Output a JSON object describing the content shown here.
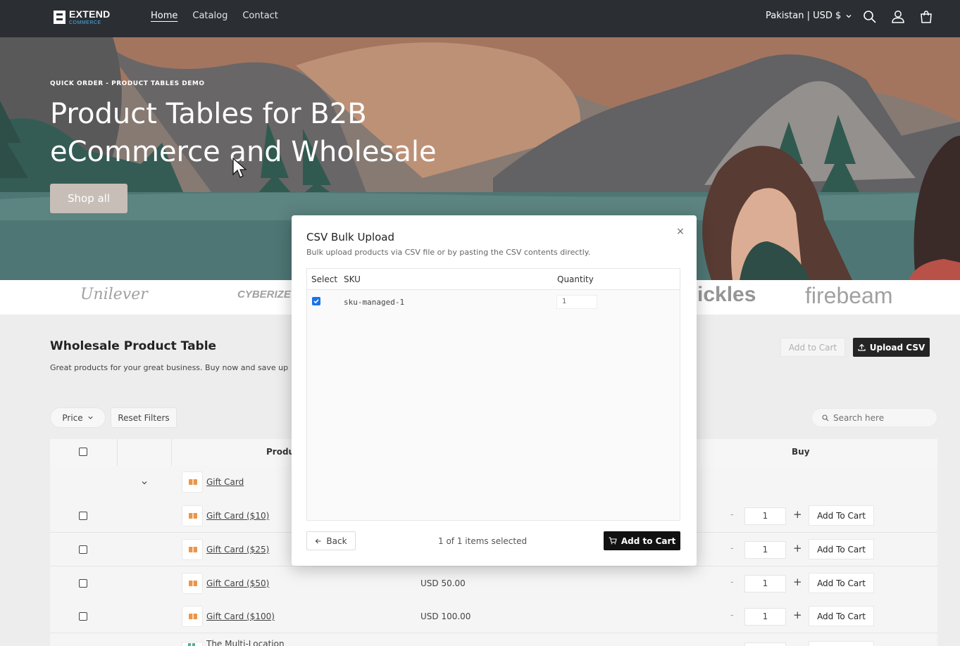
{
  "header": {
    "logo_main": "EXTEND",
    "logo_sub": "COMMERCE",
    "nav": [
      "Home",
      "Catalog",
      "Contact"
    ],
    "active_nav": "Home",
    "locale": "Pakistan | USD $"
  },
  "hero": {
    "eyebrow": "QUICK ORDER - PRODUCT TABLES DEMO",
    "title_line1": "Product Tables for B2B",
    "title_line2": "eCommerce and Wholesale",
    "cta": "Shop all"
  },
  "brands": [
    "Unilever",
    "CYBERIZE",
    "ickles",
    "firebeam"
  ],
  "section": {
    "title": "Wholesale Product Table",
    "desc": "Great products for your great business. Buy now and save up",
    "add_to_cart": "Add to Cart",
    "upload_csv": "Upload CSV",
    "filter_price": "Price",
    "reset_filters": "Reset Filters",
    "search_placeholder": "Search here",
    "col_product": "Produ",
    "col_buy": "Buy"
  },
  "rows": [
    {
      "name": "Gift Card",
      "price": "",
      "qty": ""
    },
    {
      "name": "Gift Card ($10)",
      "price": "",
      "qty": "1",
      "button": "Add To Cart"
    },
    {
      "name": "Gift Card ($25)",
      "price": "",
      "qty": "1",
      "button": "Add To Cart"
    },
    {
      "name": "Gift Card ($50)",
      "price": "USD 50.00",
      "qty": "1",
      "button": "Add To Cart"
    },
    {
      "name": "Gift Card ($100)",
      "price": "USD 100.00",
      "qty": "1",
      "button": "Add To Cart"
    },
    {
      "name": "The Multi-Location",
      "price": "",
      "qty": ""
    }
  ],
  "modal": {
    "title": "CSV Bulk Upload",
    "subtitle": "Bulk upload products via CSV file or by pasting the CSV contents directly.",
    "close": "×",
    "col_select": "Select",
    "col_sku": "SKU",
    "col_quantity": "Quantity",
    "items": [
      {
        "sku": "sku-managed-1",
        "quantity": "1",
        "selected": true
      }
    ],
    "back": "Back",
    "selected_count": "1 of 1 items selected",
    "add_to_cart": "Add to Cart"
  }
}
